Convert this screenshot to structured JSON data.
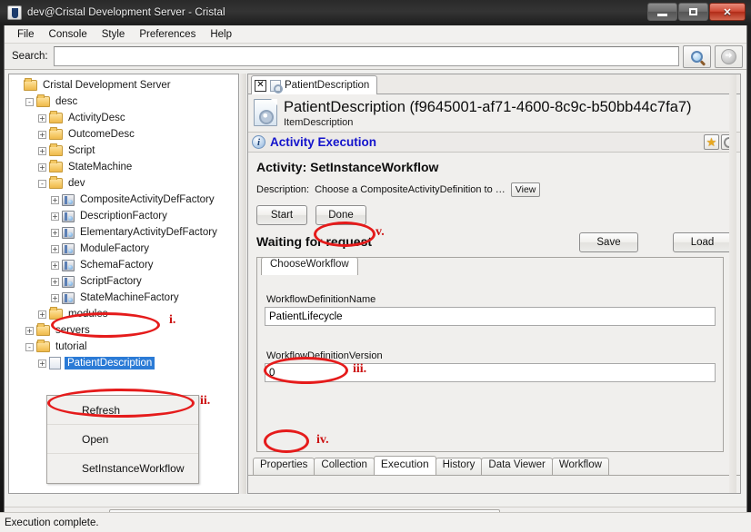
{
  "window": {
    "title": "dev@Cristal Development Server - Cristal",
    "icon": "java-app-icon",
    "buttons": {
      "minimize": "minimize-button",
      "maximize": "maximize-button",
      "close": "close-button"
    }
  },
  "menubar": {
    "items": [
      "File",
      "Console",
      "Style",
      "Preferences",
      "Help"
    ]
  },
  "search": {
    "label": "Search:",
    "value": "",
    "placeholder": "",
    "search_button_icon": "magnifier-icon",
    "go_button_icon": "arrow-right-circle-icon"
  },
  "tree": {
    "root": "Cristal Development Server",
    "nodes": [
      {
        "label": "Cristal Development Server",
        "depth": 0,
        "toggle": "none",
        "icon": "folder-icon"
      },
      {
        "label": "desc",
        "depth": 1,
        "toggle": "-",
        "icon": "folder-icon"
      },
      {
        "label": "ActivityDesc",
        "depth": 2,
        "toggle": "+",
        "icon": "folder-icon"
      },
      {
        "label": "OutcomeDesc",
        "depth": 2,
        "toggle": "+",
        "icon": "folder-icon"
      },
      {
        "label": "Script",
        "depth": 2,
        "toggle": "+",
        "icon": "folder-icon"
      },
      {
        "label": "StateMachine",
        "depth": 2,
        "toggle": "+",
        "icon": "folder-icon"
      },
      {
        "label": "dev",
        "depth": 2,
        "toggle": "-",
        "icon": "folder-icon"
      },
      {
        "label": "CompositeActivityDefFactory",
        "depth": 3,
        "toggle": "+",
        "icon": "factory-icon"
      },
      {
        "label": "DescriptionFactory",
        "depth": 3,
        "toggle": "+",
        "icon": "factory-icon"
      },
      {
        "label": "ElementaryActivityDefFactory",
        "depth": 3,
        "toggle": "+",
        "icon": "factory-icon"
      },
      {
        "label": "ModuleFactory",
        "depth": 3,
        "toggle": "+",
        "icon": "factory-icon"
      },
      {
        "label": "SchemaFactory",
        "depth": 3,
        "toggle": "+",
        "icon": "factory-icon"
      },
      {
        "label": "ScriptFactory",
        "depth": 3,
        "toggle": "+",
        "icon": "factory-icon"
      },
      {
        "label": "StateMachineFactory",
        "depth": 3,
        "toggle": "+",
        "icon": "factory-icon"
      },
      {
        "label": "modules",
        "depth": 2,
        "toggle": "+",
        "icon": "folder-icon"
      },
      {
        "label": "servers",
        "depth": 1,
        "toggle": "+",
        "icon": "folder-icon"
      },
      {
        "label": "tutorial",
        "depth": 1,
        "toggle": "-",
        "icon": "folder-icon"
      },
      {
        "label": "PatientDescription",
        "depth": 2,
        "toggle": "+",
        "icon": "item-icon",
        "selected": true
      }
    ]
  },
  "context_menu": {
    "items": [
      "Refresh",
      "Open",
      "SetInstanceWorkflow"
    ]
  },
  "document_tab": {
    "label": "PatientDescription",
    "close_icon": "close-icon",
    "tab_icon": "document-icon"
  },
  "document_header": {
    "icon": "item-description-icon",
    "title": "PatientDescription (f9645001-af71-4600-8c9c-b50bb44c7fa7)",
    "subtitle": "ItemDescription"
  },
  "section": {
    "info_icon": "info-icon",
    "title": "Activity Execution",
    "favorite_icon": "star-icon",
    "refresh_icon": "refresh-icon"
  },
  "activity": {
    "heading": "Activity: SetInstanceWorkflow",
    "description_label": "Description:",
    "description_text": "Choose a CompositeActivityDefinition to  …",
    "view_button": "View",
    "start_button": "Start",
    "done_button": "Done",
    "waiting_text": "Waiting for request",
    "save_button": "Save",
    "load_button": "Load"
  },
  "form": {
    "tab_label": "ChooseWorkflow",
    "fields": [
      {
        "label": "WorkflowDefinitionName",
        "value": "PatientLifecycle"
      },
      {
        "label": "WorkflowDefinitionVersion",
        "value": "0"
      }
    ]
  },
  "bottom_tabs": {
    "items": [
      "Properties",
      "Collection",
      "Execution",
      "History",
      "Data Viewer",
      "Workflow"
    ],
    "active": "Execution"
  },
  "statusbar": {
    "text": "Execution complete."
  },
  "annotations": [
    {
      "id": "i",
      "label": "i.",
      "target": "tree-selected-node"
    },
    {
      "id": "ii",
      "label": "ii.",
      "target": "context-menu-setinstanceworkflow"
    },
    {
      "id": "iii",
      "label": "iii.",
      "target": "workflow-definition-name-input"
    },
    {
      "id": "iv",
      "label": "iv.",
      "target": "workflow-definition-version-input"
    },
    {
      "id": "v",
      "label": "v.",
      "target": "done-button"
    }
  ],
  "colors": {
    "annotation": "#e51b1b",
    "annotation_text": "#cc1111",
    "selection": "#2b7bd6",
    "section_title": "#1414cc"
  }
}
